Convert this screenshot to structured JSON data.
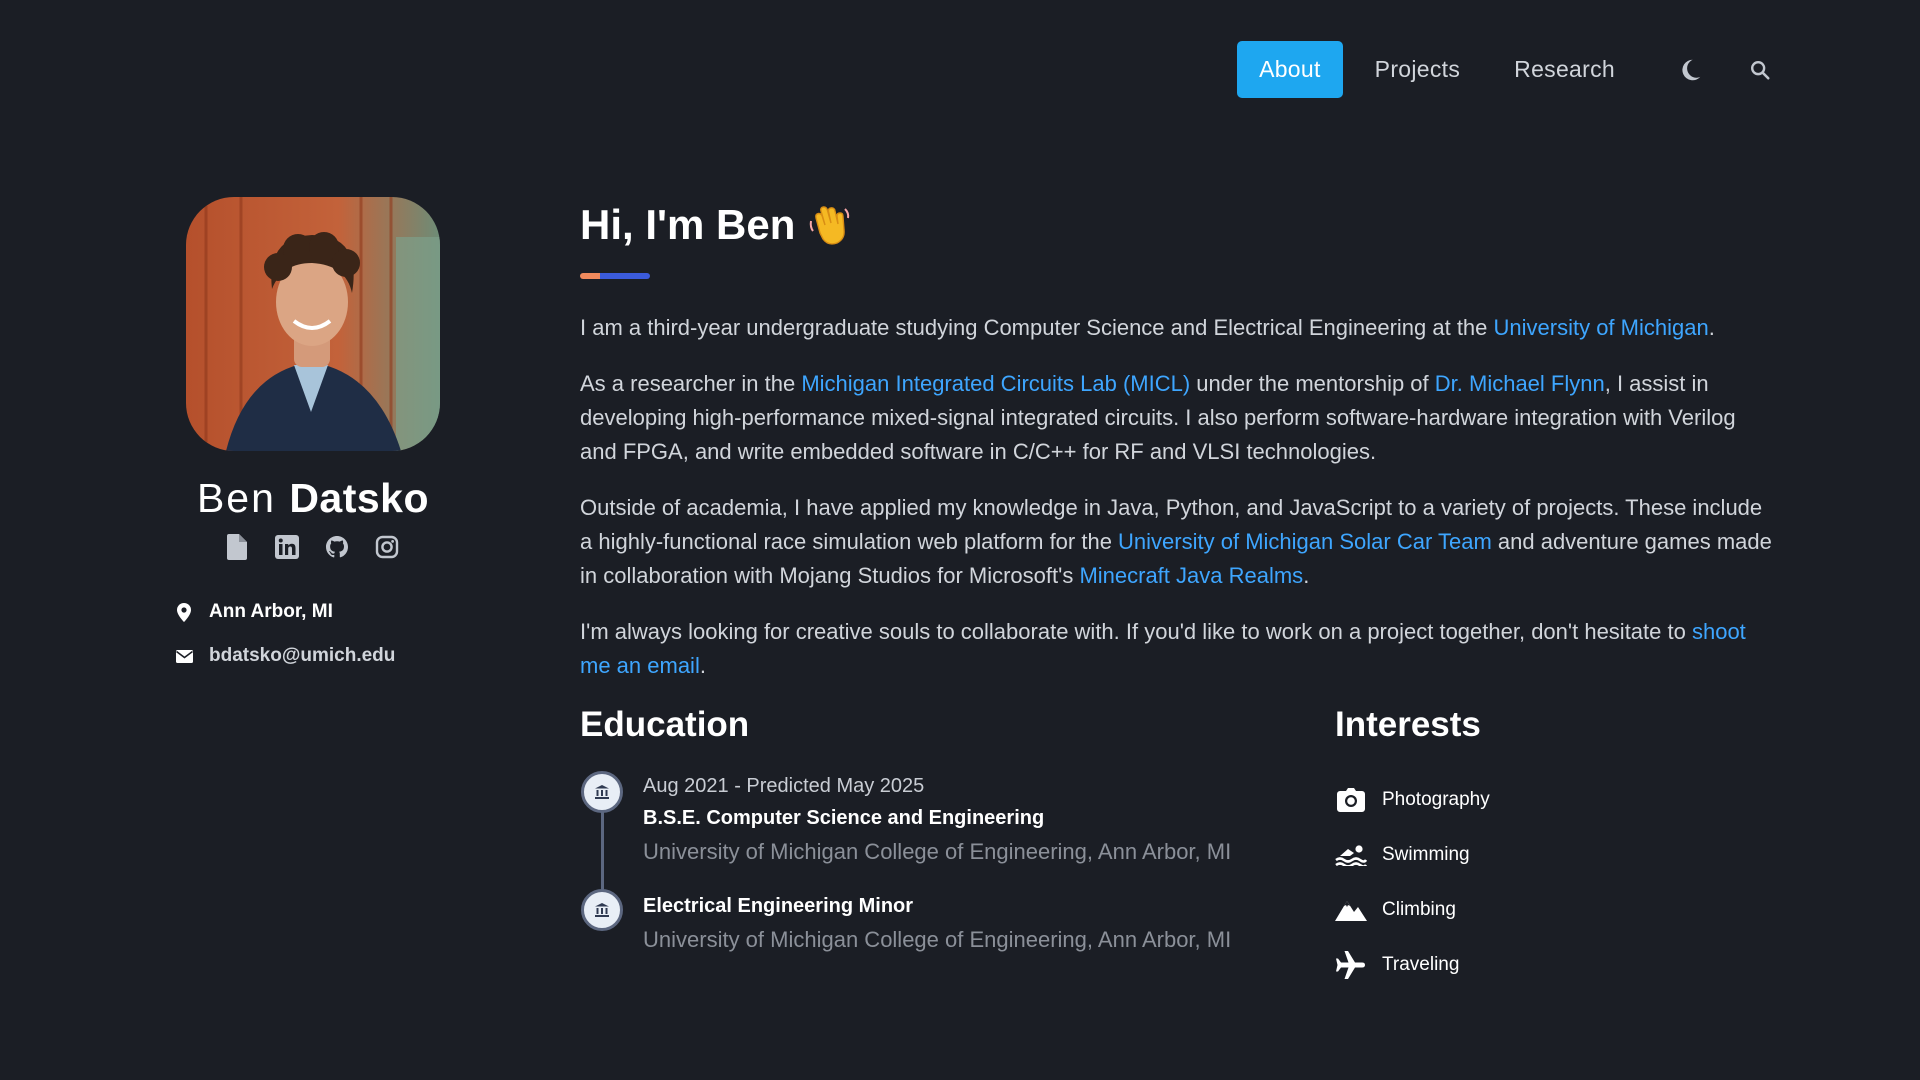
{
  "nav": {
    "items": [
      {
        "label": "About",
        "active": true
      },
      {
        "label": "Projects",
        "active": false
      },
      {
        "label": "Research",
        "active": false
      }
    ],
    "icons": [
      "moon-icon",
      "search-icon"
    ]
  },
  "profile": {
    "first_name": "Ben",
    "last_name": "Datsko",
    "social_icons": [
      "document-icon",
      "linkedin-icon",
      "github-icon",
      "instagram-icon"
    ],
    "location": "Ann Arbor, MI",
    "email": "bdatsko@umich.edu"
  },
  "intro": {
    "heading": "Hi, I'm Ben",
    "p1": {
      "text_a": "I am a third-year undergraduate studying Computer Science and Electrical Engineering at the ",
      "link": "University of Michigan",
      "text_b": "."
    },
    "p2": {
      "text_a": "As a researcher in the ",
      "link1": "Michigan Integrated Circuits Lab (MICL)",
      "text_b": " under the mentorship of ",
      "link2": "Dr. Michael Flynn",
      "text_c": ", I assist in developing high-performance mixed-signal integrated circuits. I also perform software-hardware integration with Verilog and FPGA, and write embedded software in C/C++ for RF and VLSI technologies."
    },
    "p3": {
      "text_a": "Outside of academia, I have applied my knowledge in Java, Python, and JavaScript to a variety of projects. These include a highly-functional race simulation web platform for the ",
      "link1": "University of Michigan Solar Car Team",
      "text_b": " and adventure games made in collaboration with Mojang Studios for Microsoft's ",
      "link2": "Minecraft Java Realms",
      "text_c": "."
    },
    "p4": {
      "text_a": "I'm always looking for creative souls to collaborate with. If you'd like to work on a project together, don't hesitate to ",
      "link": "shoot me an email",
      "text_b": "."
    }
  },
  "education": {
    "title": "Education",
    "items": [
      {
        "date": "Aug 2021 - Predicted May 2025",
        "degree": "B.S.E. Computer Science and Engineering",
        "school": "University of Michigan College of Engineering, Ann Arbor, MI"
      },
      {
        "degree": "Electrical Engineering Minor",
        "school": "University of Michigan College of Engineering, Ann Arbor, MI"
      }
    ]
  },
  "interests": {
    "title": "Interests",
    "items": [
      {
        "label": "Photography",
        "icon": "camera-icon"
      },
      {
        "label": "Swimming",
        "icon": "swimmer-icon"
      },
      {
        "label": "Climbing",
        "icon": "mountain-icon"
      },
      {
        "label": "Traveling",
        "icon": "plane-icon"
      }
    ]
  },
  "colors": {
    "background": "#1b1e25",
    "accent": "#1ea7f0",
    "link": "#3ea6ff",
    "underline_orange": "#f08a5d",
    "underline_blue": "#3b5bdb"
  }
}
